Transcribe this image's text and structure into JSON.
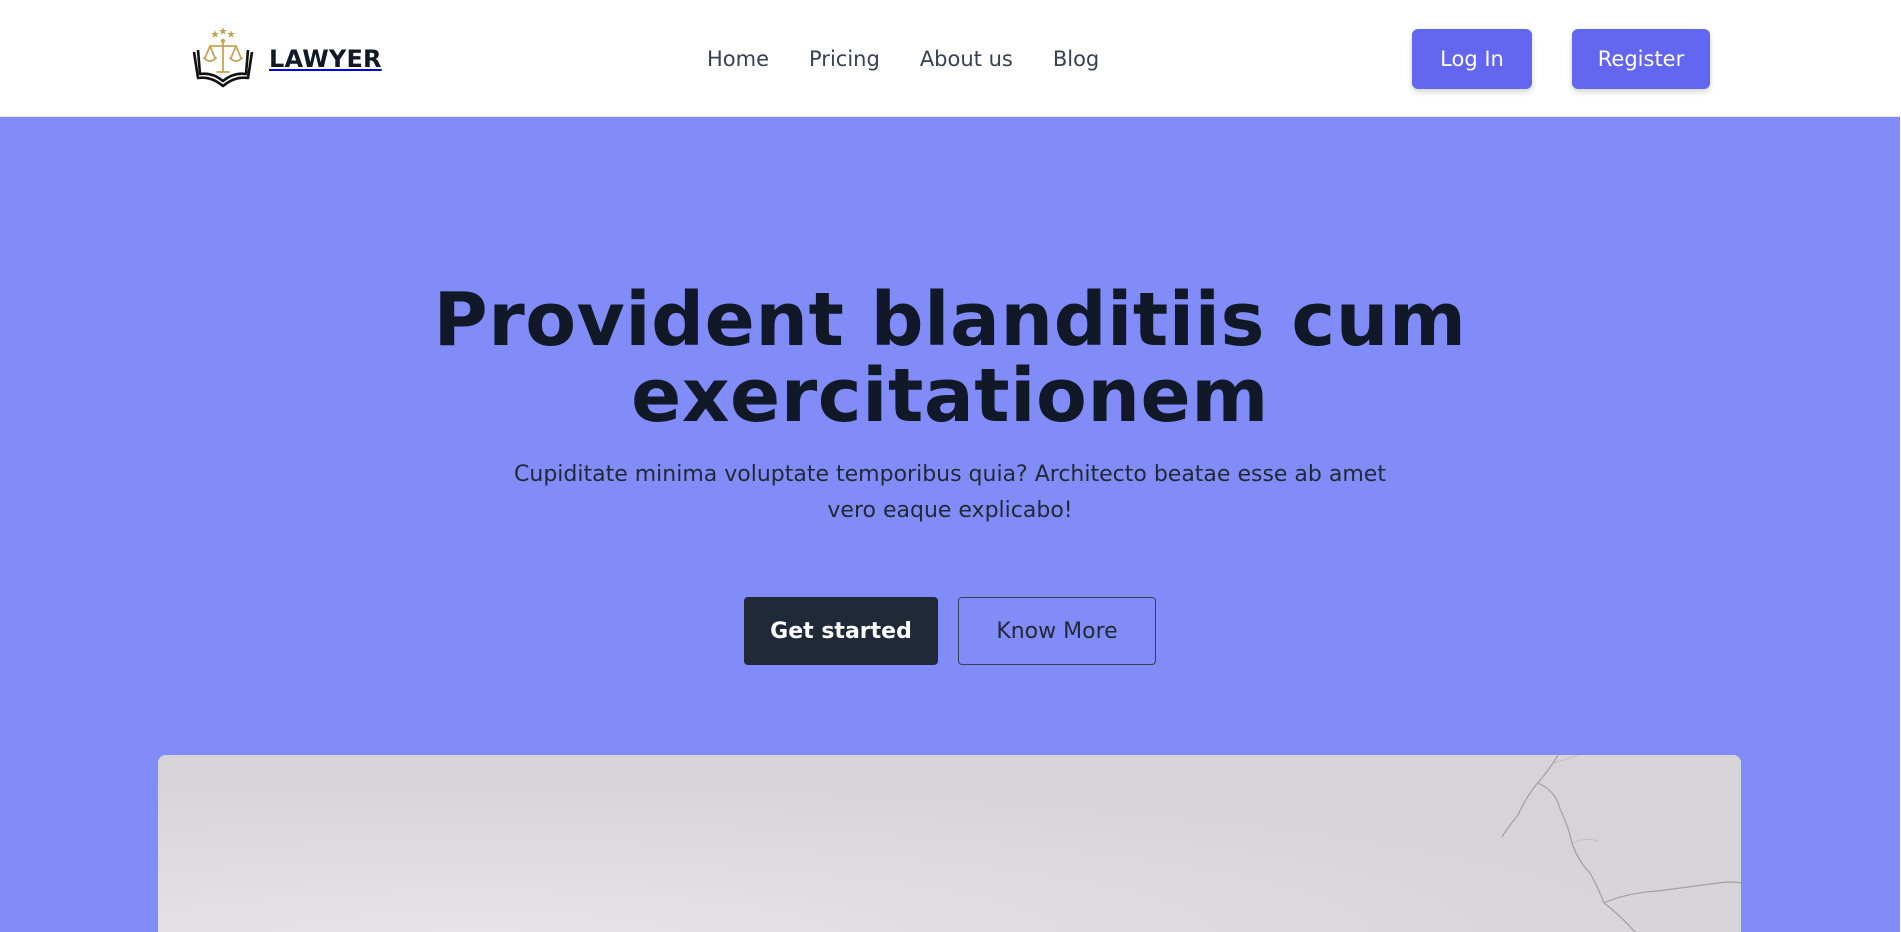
{
  "header": {
    "brand": {
      "name": "LAWYER",
      "logo_icon": "scales-of-justice-book-logo",
      "logo_colors": {
        "gold": "#c9a25a",
        "ink": "#111111"
      }
    },
    "nav": [
      {
        "label": "Home"
      },
      {
        "label": "Pricing"
      },
      {
        "label": "About us"
      },
      {
        "label": "Blog"
      }
    ],
    "login_label": "Log In",
    "register_label": "Register"
  },
  "hero": {
    "title_line1": "Provident blanditiis cum",
    "title_line2": "exercitationem",
    "subtitle": "Cupiditate minima voluptate temporibus quia? Architecto beatae esse ab amet vero eaque explicabo!",
    "primary_cta": "Get started",
    "secondary_cta": "Know More",
    "image_icon": "marble-texture-image"
  },
  "colors": {
    "accent": "#6366f1",
    "hero_background": "#818cf8",
    "dark": "#1f2937",
    "header_background": "#ffffff"
  }
}
